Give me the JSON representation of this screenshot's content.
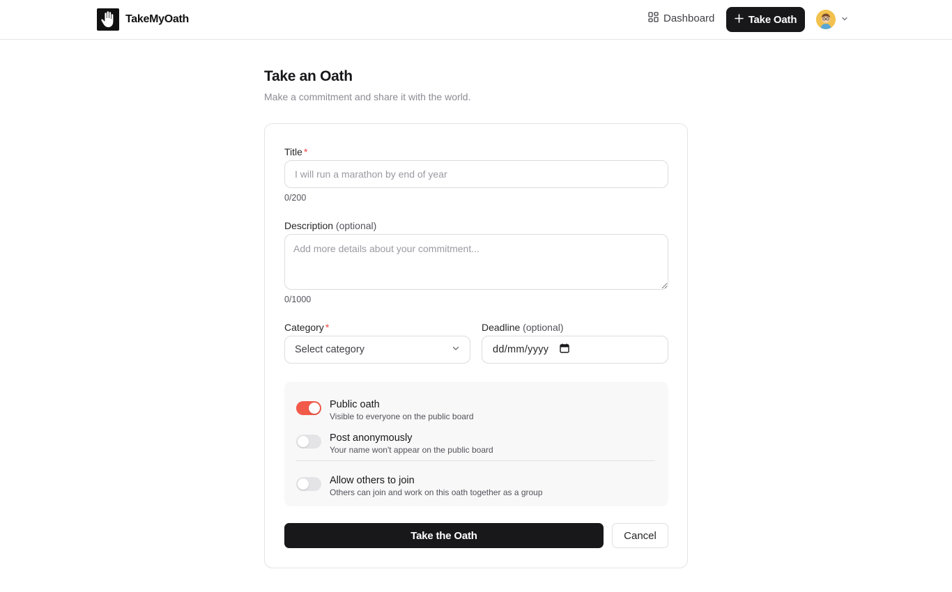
{
  "header": {
    "brand_name": "TakeMyOath",
    "nav_dashboard": "Dashboard",
    "take_oath_button": "Take Oath"
  },
  "page": {
    "title": "Take an Oath",
    "subtitle": "Make a commitment and share it with the world."
  },
  "form": {
    "title_label": "Title",
    "title_required": "*",
    "title_placeholder": "I will run a marathon by end of year",
    "title_value": "",
    "title_counter": "0/200",
    "description_label": "Description",
    "description_optional": "(optional)",
    "description_placeholder": "Add more details about your commitment...",
    "description_value": "",
    "description_counter": "0/1000",
    "category_label": "Category",
    "category_required": "*",
    "category_selected": "Select category",
    "deadline_label": "Deadline",
    "deadline_optional": "(optional)",
    "deadline_placeholder": "dd/mm/yyyy"
  },
  "options": [
    {
      "title": "Public oath",
      "description": "Visible to everyone on the public board",
      "enabled": true
    },
    {
      "title": "Post anonymously",
      "description": "Your name won't appear on the public board",
      "enabled": false
    },
    {
      "title": "Allow others to join",
      "description": "Others can join and work on this oath together as a group",
      "enabled": false
    }
  ],
  "actions": {
    "submit_label": "Take the Oath",
    "cancel_label": "Cancel"
  },
  "colors": {
    "accent_toggle": "#f25a4a",
    "primary_button": "#18181b",
    "required_star": "#ef4444"
  },
  "icons": {
    "logo": "raised-hand-icon",
    "dashboard": "grid-icon",
    "take_oath": "plus-icon",
    "avatar": "user-avatar",
    "avatar_menu": "chevron-down-icon",
    "category_select": "chevron-down-icon",
    "deadline": "calendar-icon"
  }
}
